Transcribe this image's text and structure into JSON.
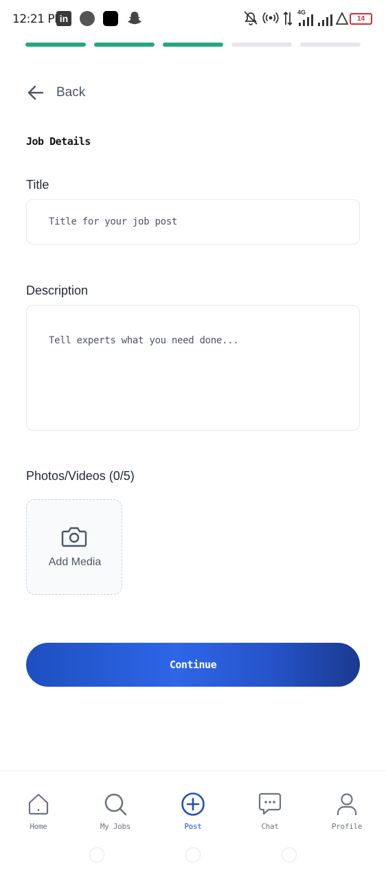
{
  "status_bar": {
    "time": "12:21 PM",
    "linkedin_glyph": "in",
    "network": "4G",
    "battery": "14",
    "icons": [
      "linkedin-icon",
      "circle-app-icon",
      "square-app-icon",
      "snapchat-icon",
      "bell-off-icon",
      "hotspot-icon",
      "data-arrows-icon",
      "signal-icon",
      "signal-icon",
      "alert-icon",
      "battery-icon"
    ]
  },
  "progress": {
    "total_steps": 5,
    "completed_steps": 3,
    "colors": {
      "done": "#22a883",
      "pending": "#e5e7eb"
    }
  },
  "header": {
    "back_label": "Back",
    "back_icon": "arrow-left-icon"
  },
  "section_title": "Job Details",
  "form": {
    "title_label": "Title",
    "title_placeholder": "Title for your job post",
    "description_label": "Description",
    "description_placeholder": "Tell experts what you need done...",
    "media_label": "Photos/Videos (0/5)",
    "add_media_label": "Add Media",
    "add_media_icon": "camera-icon"
  },
  "continue_label": "Continue",
  "accent_color": "#1e4fc0",
  "bottom_nav": {
    "items": [
      {
        "label": "Home",
        "icon": "home-icon",
        "active": false
      },
      {
        "label": "My Jobs",
        "icon": "search-icon",
        "active": false
      },
      {
        "label": "Post",
        "icon": "plus-circle-icon",
        "active": true
      },
      {
        "label": "Chat",
        "icon": "chat-icon",
        "active": false
      },
      {
        "label": "Profile",
        "icon": "user-icon",
        "active": false
      }
    ]
  }
}
